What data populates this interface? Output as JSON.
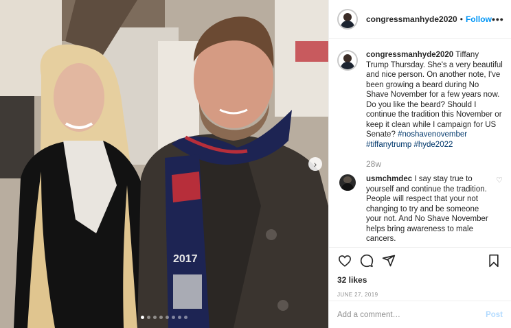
{
  "post": {
    "carousel_total": 8,
    "carousel_active_index": 0,
    "scarf_text": "2017"
  },
  "header": {
    "username": "congressmanhyde2020",
    "separator": "•",
    "follow_label": "Follow",
    "more_label": "•••"
  },
  "caption": {
    "username": "congressmanhyde2020",
    "text": "Tiffany Trump Thursday. She's a very beautiful and nice person. On another note, I've been growing a beard during No Shave November for a few years now. Do you like the beard? Should I continue the tradition this November or keep it clean while I campaign for US Senate?",
    "hashtags": [
      "#noshavenovember",
      "#tiffanytrump",
      "#hyde2022"
    ],
    "time": "28w"
  },
  "comments": [
    {
      "username": "usmchmdec",
      "text": "I say stay true to yourself and continue the tradition. People will respect that your not changing to try and be someone your not. And No Shave November helps bring awareness to male cancers."
    }
  ],
  "actions": {
    "like_icon": "heart-icon",
    "comment_icon": "comment-icon",
    "share_icon": "share-icon",
    "save_icon": "bookmark-icon"
  },
  "likes": "32 likes",
  "date": "JUNE 27, 2019",
  "add_comment": {
    "placeholder": "Add a comment…",
    "post_label": "Post"
  },
  "colors": {
    "accent": "#0095f6",
    "hashtag": "#00376b",
    "muted": "#8e8e8e",
    "post_disabled": "#b3dbff"
  }
}
